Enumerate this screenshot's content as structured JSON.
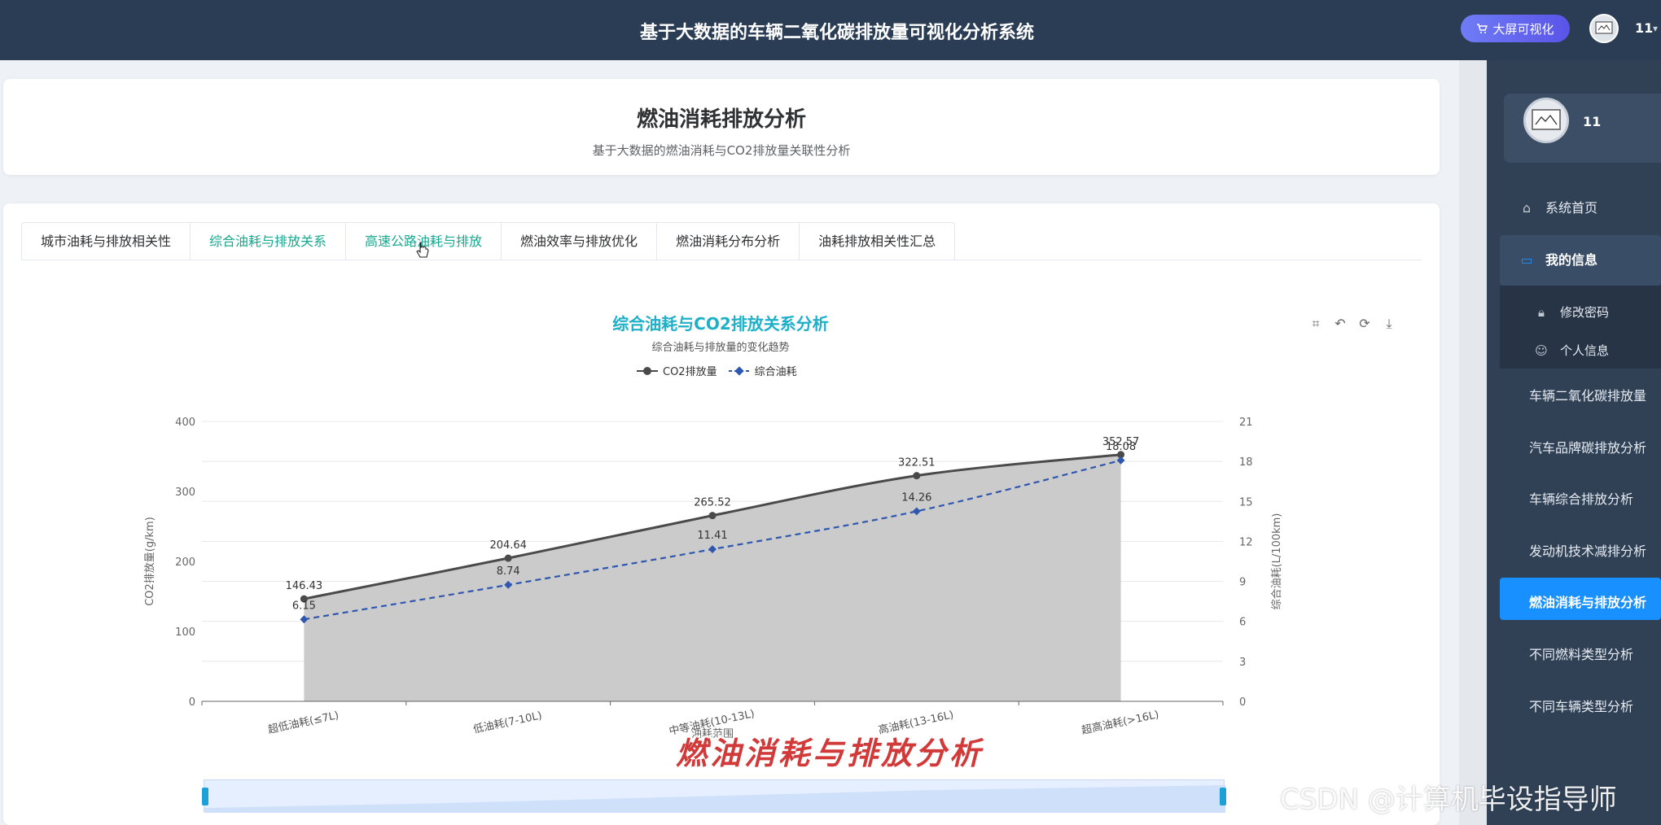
{
  "header": {
    "title": "基于大数据的车辆二氧化碳排放量可视化分析系统",
    "bigscreen_label": "大屏可视化",
    "username": "11"
  },
  "sidebar": {
    "profile_name": "11",
    "items": [
      {
        "label": "系统首页",
        "icon": "home-icon"
      },
      {
        "label": "我的信息",
        "icon": "info-icon"
      },
      {
        "label": "修改密码",
        "icon": "lock-icon"
      },
      {
        "label": "个人信息",
        "icon": "user-icon"
      },
      {
        "label": "车辆二氧化碳排放量"
      },
      {
        "label": "汽车品牌碳排放分析"
      },
      {
        "label": "车辆综合排放分析"
      },
      {
        "label": "发动机技术减排分析"
      },
      {
        "label": "燃油消耗与排放分析"
      },
      {
        "label": "不同燃料类型分析"
      },
      {
        "label": "不同车辆类型分析"
      }
    ],
    "active_index": 8
  },
  "page": {
    "title": "燃油消耗排放分析",
    "subtitle": "基于大数据的燃油消耗与CO2排放量关联性分析"
  },
  "tabs": [
    {
      "label": "城市油耗与排放相关性"
    },
    {
      "label": "综合油耗与排放关系"
    },
    {
      "label": "高速公路油耗与排放"
    },
    {
      "label": "燃油效率与排放优化"
    },
    {
      "label": "燃油消耗分布分析"
    },
    {
      "label": "油耗排放相关性汇总"
    }
  ],
  "active_tab": 1,
  "overlay": {
    "caption": "燃油消耗与排放分析",
    "csdn": "CSDN @计算机毕设指导师"
  },
  "colors": {
    "header_bg": "#2b3d55",
    "sidebar_bg": "#304156",
    "active_nav": "#1890ff",
    "tab_active": "#16a98f",
    "chart_title": "#1eb0c8",
    "co2_line": "#4a4a4a",
    "fuel_line": "#2f57b0",
    "area_fill": "#c8c8c8"
  },
  "chart_data": {
    "type": "line",
    "title": "综合油耗与CO2排放关系分析",
    "subtitle": "综合油耗与排放量的变化趋势",
    "categories": [
      "超低油耗(≤7L)",
      "低油耗(7-10L)",
      "中等油耗(10-13L)",
      "高油耗(13-16L)",
      "超高油耗(>16L)"
    ],
    "xlabel": "油耗范围",
    "series": [
      {
        "name": "CO2排放量",
        "axis": "left",
        "values": [
          146.43,
          204.64,
          265.52,
          322.51,
          352.57
        ],
        "labels": [
          "146.43",
          "204.64",
          "265.52",
          "322.51",
          "352.57"
        ]
      },
      {
        "name": "综合油耗",
        "axis": "right",
        "values": [
          6.15,
          8.74,
          11.41,
          14.26,
          18.08
        ],
        "labels": [
          "6.15",
          "8.74",
          "11.41",
          "14.26",
          "18.08"
        ]
      }
    ],
    "ylabel": "CO2排放量(g/km)",
    "ylim": [
      0,
      400
    ],
    "yticks": [
      "0",
      "100",
      "200",
      "300",
      "400"
    ],
    "y2label": "综合油耗(L/100km)",
    "y2lim": [
      0,
      21
    ],
    "y2ticks": [
      "0",
      "3",
      "6",
      "9",
      "12",
      "15",
      "18",
      "21"
    ],
    "grid": true,
    "legend": "top-center"
  }
}
